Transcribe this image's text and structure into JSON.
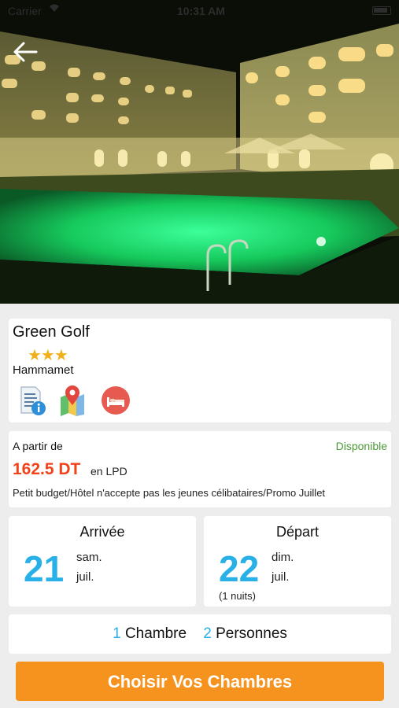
{
  "status_bar": {
    "carrier": "Carrier",
    "time": "10:31 AM"
  },
  "hotel": {
    "name": "Green Golf",
    "stars": "★★★",
    "star_count": 3,
    "city": "Hammamet",
    "icons": [
      "info-document-icon",
      "map-icon",
      "bed-icon"
    ]
  },
  "price": {
    "from_label": "A partir de",
    "availability": "Disponible",
    "amount": "162.5 DT",
    "board": "en LPD",
    "description": "Petit budget/Hôtel n'accepte pas les jeunes célibataires/Promo Juillet"
  },
  "arrival": {
    "title": "Arrivée",
    "day": "21",
    "weekday": "sam.",
    "month": "juil."
  },
  "departure": {
    "title": "Départ",
    "day": "22",
    "weekday": "dim.",
    "month": "juil.",
    "nights": "(1 nuits)"
  },
  "rooms": {
    "room_count": "1",
    "room_label": "Chambre",
    "person_count": "2",
    "person_label": "Personnes"
  },
  "cta": {
    "label": "Choisir Vos Chambres"
  },
  "colors": {
    "accent_blue": "#29b0e7",
    "price_red": "#f0421b",
    "available_green": "#4c9a36",
    "cta_orange": "#f6921e",
    "star_gold": "#f0b21c"
  }
}
